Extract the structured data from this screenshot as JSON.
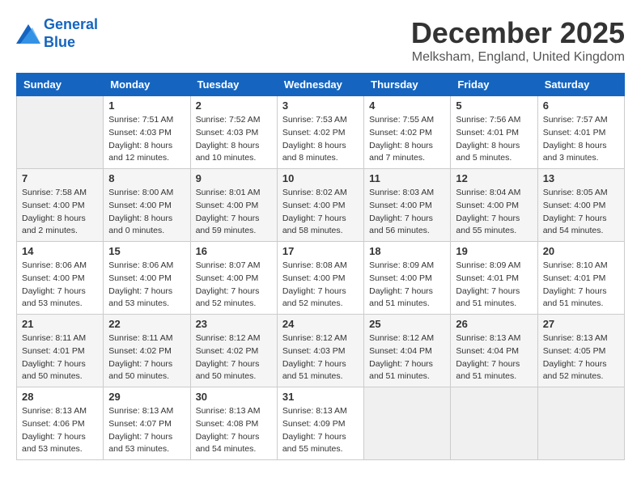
{
  "logo": {
    "line1": "General",
    "line2": "Blue"
  },
  "header": {
    "month": "December 2025",
    "location": "Melksham, England, United Kingdom"
  },
  "weekdays": [
    "Sunday",
    "Monday",
    "Tuesday",
    "Wednesday",
    "Thursday",
    "Friday",
    "Saturday"
  ],
  "weeks": [
    [
      {
        "day": "",
        "sunrise": "",
        "sunset": "",
        "daylight": ""
      },
      {
        "day": "1",
        "sunrise": "Sunrise: 7:51 AM",
        "sunset": "Sunset: 4:03 PM",
        "daylight": "Daylight: 8 hours and 12 minutes."
      },
      {
        "day": "2",
        "sunrise": "Sunrise: 7:52 AM",
        "sunset": "Sunset: 4:03 PM",
        "daylight": "Daylight: 8 hours and 10 minutes."
      },
      {
        "day": "3",
        "sunrise": "Sunrise: 7:53 AM",
        "sunset": "Sunset: 4:02 PM",
        "daylight": "Daylight: 8 hours and 8 minutes."
      },
      {
        "day": "4",
        "sunrise": "Sunrise: 7:55 AM",
        "sunset": "Sunset: 4:02 PM",
        "daylight": "Daylight: 8 hours and 7 minutes."
      },
      {
        "day": "5",
        "sunrise": "Sunrise: 7:56 AM",
        "sunset": "Sunset: 4:01 PM",
        "daylight": "Daylight: 8 hours and 5 minutes."
      },
      {
        "day": "6",
        "sunrise": "Sunrise: 7:57 AM",
        "sunset": "Sunset: 4:01 PM",
        "daylight": "Daylight: 8 hours and 3 minutes."
      }
    ],
    [
      {
        "day": "7",
        "sunrise": "Sunrise: 7:58 AM",
        "sunset": "Sunset: 4:00 PM",
        "daylight": "Daylight: 8 hours and 2 minutes."
      },
      {
        "day": "8",
        "sunrise": "Sunrise: 8:00 AM",
        "sunset": "Sunset: 4:00 PM",
        "daylight": "Daylight: 8 hours and 0 minutes."
      },
      {
        "day": "9",
        "sunrise": "Sunrise: 8:01 AM",
        "sunset": "Sunset: 4:00 PM",
        "daylight": "Daylight: 7 hours and 59 minutes."
      },
      {
        "day": "10",
        "sunrise": "Sunrise: 8:02 AM",
        "sunset": "Sunset: 4:00 PM",
        "daylight": "Daylight: 7 hours and 58 minutes."
      },
      {
        "day": "11",
        "sunrise": "Sunrise: 8:03 AM",
        "sunset": "Sunset: 4:00 PM",
        "daylight": "Daylight: 7 hours and 56 minutes."
      },
      {
        "day": "12",
        "sunrise": "Sunrise: 8:04 AM",
        "sunset": "Sunset: 4:00 PM",
        "daylight": "Daylight: 7 hours and 55 minutes."
      },
      {
        "day": "13",
        "sunrise": "Sunrise: 8:05 AM",
        "sunset": "Sunset: 4:00 PM",
        "daylight": "Daylight: 7 hours and 54 minutes."
      }
    ],
    [
      {
        "day": "14",
        "sunrise": "Sunrise: 8:06 AM",
        "sunset": "Sunset: 4:00 PM",
        "daylight": "Daylight: 7 hours and 53 minutes."
      },
      {
        "day": "15",
        "sunrise": "Sunrise: 8:06 AM",
        "sunset": "Sunset: 4:00 PM",
        "daylight": "Daylight: 7 hours and 53 minutes."
      },
      {
        "day": "16",
        "sunrise": "Sunrise: 8:07 AM",
        "sunset": "Sunset: 4:00 PM",
        "daylight": "Daylight: 7 hours and 52 minutes."
      },
      {
        "day": "17",
        "sunrise": "Sunrise: 8:08 AM",
        "sunset": "Sunset: 4:00 PM",
        "daylight": "Daylight: 7 hours and 52 minutes."
      },
      {
        "day": "18",
        "sunrise": "Sunrise: 8:09 AM",
        "sunset": "Sunset: 4:00 PM",
        "daylight": "Daylight: 7 hours and 51 minutes."
      },
      {
        "day": "19",
        "sunrise": "Sunrise: 8:09 AM",
        "sunset": "Sunset: 4:01 PM",
        "daylight": "Daylight: 7 hours and 51 minutes."
      },
      {
        "day": "20",
        "sunrise": "Sunrise: 8:10 AM",
        "sunset": "Sunset: 4:01 PM",
        "daylight": "Daylight: 7 hours and 51 minutes."
      }
    ],
    [
      {
        "day": "21",
        "sunrise": "Sunrise: 8:11 AM",
        "sunset": "Sunset: 4:01 PM",
        "daylight": "Daylight: 7 hours and 50 minutes."
      },
      {
        "day": "22",
        "sunrise": "Sunrise: 8:11 AM",
        "sunset": "Sunset: 4:02 PM",
        "daylight": "Daylight: 7 hours and 50 minutes."
      },
      {
        "day": "23",
        "sunrise": "Sunrise: 8:12 AM",
        "sunset": "Sunset: 4:02 PM",
        "daylight": "Daylight: 7 hours and 50 minutes."
      },
      {
        "day": "24",
        "sunrise": "Sunrise: 8:12 AM",
        "sunset": "Sunset: 4:03 PM",
        "daylight": "Daylight: 7 hours and 51 minutes."
      },
      {
        "day": "25",
        "sunrise": "Sunrise: 8:12 AM",
        "sunset": "Sunset: 4:04 PM",
        "daylight": "Daylight: 7 hours and 51 minutes."
      },
      {
        "day": "26",
        "sunrise": "Sunrise: 8:13 AM",
        "sunset": "Sunset: 4:04 PM",
        "daylight": "Daylight: 7 hours and 51 minutes."
      },
      {
        "day": "27",
        "sunrise": "Sunrise: 8:13 AM",
        "sunset": "Sunset: 4:05 PM",
        "daylight": "Daylight: 7 hours and 52 minutes."
      }
    ],
    [
      {
        "day": "28",
        "sunrise": "Sunrise: 8:13 AM",
        "sunset": "Sunset: 4:06 PM",
        "daylight": "Daylight: 7 hours and 53 minutes."
      },
      {
        "day": "29",
        "sunrise": "Sunrise: 8:13 AM",
        "sunset": "Sunset: 4:07 PM",
        "daylight": "Daylight: 7 hours and 53 minutes."
      },
      {
        "day": "30",
        "sunrise": "Sunrise: 8:13 AM",
        "sunset": "Sunset: 4:08 PM",
        "daylight": "Daylight: 7 hours and 54 minutes."
      },
      {
        "day": "31",
        "sunrise": "Sunrise: 8:13 AM",
        "sunset": "Sunset: 4:09 PM",
        "daylight": "Daylight: 7 hours and 55 minutes."
      },
      {
        "day": "",
        "sunrise": "",
        "sunset": "",
        "daylight": ""
      },
      {
        "day": "",
        "sunrise": "",
        "sunset": "",
        "daylight": ""
      },
      {
        "day": "",
        "sunrise": "",
        "sunset": "",
        "daylight": ""
      }
    ]
  ]
}
